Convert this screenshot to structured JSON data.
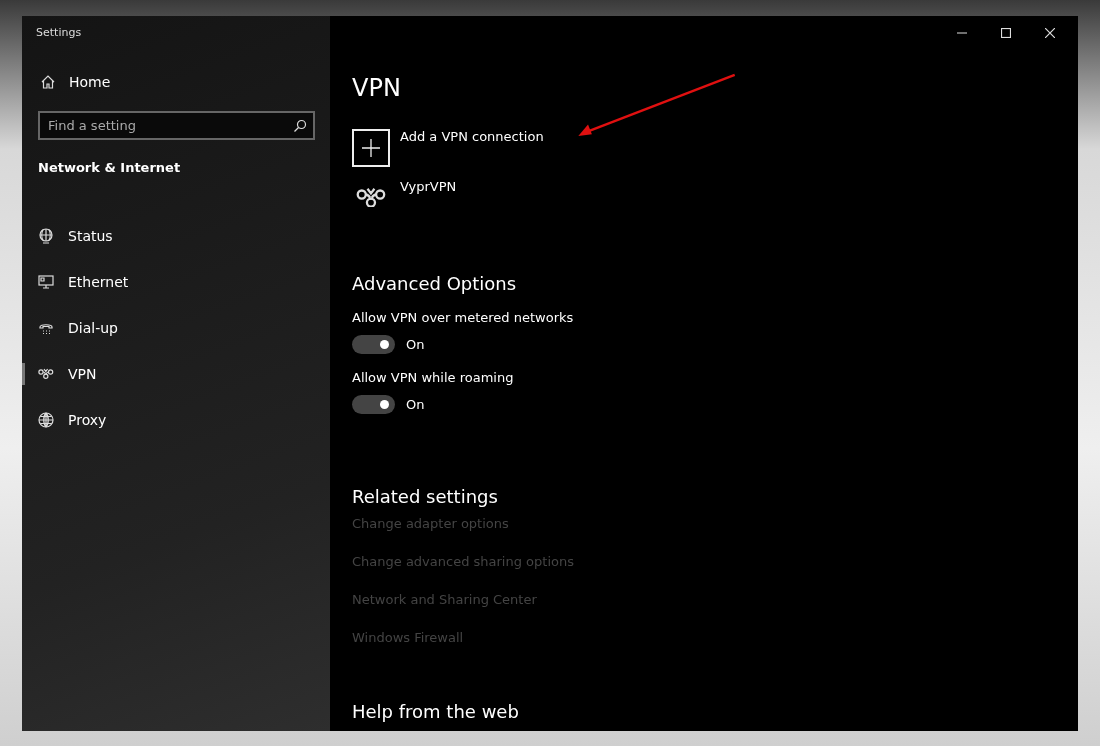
{
  "window": {
    "title": "Settings"
  },
  "sidebar": {
    "home": "Home",
    "search": {
      "placeholder": "Find a setting"
    },
    "section": "Network & Internet",
    "items": [
      {
        "label": "Status",
        "kind": "status",
        "selected": false
      },
      {
        "label": "Ethernet",
        "kind": "ethernet",
        "selected": false
      },
      {
        "label": "Dial-up",
        "kind": "dialup",
        "selected": false
      },
      {
        "label": "VPN",
        "kind": "vpn",
        "selected": true
      },
      {
        "label": "Proxy",
        "kind": "proxy",
        "selected": false
      }
    ]
  },
  "content": {
    "title": "VPN",
    "connections": [
      {
        "kind": "add",
        "label": "Add a VPN connection"
      },
      {
        "kind": "vpn",
        "label": "VyprVPN"
      }
    ],
    "advanced": {
      "heading": "Advanced Options",
      "toggles": [
        {
          "label": "Allow VPN over metered networks",
          "on": true,
          "state": "On"
        },
        {
          "label": "Allow VPN while roaming",
          "on": true,
          "state": "On"
        }
      ]
    },
    "related": {
      "heading": "Related settings",
      "links": [
        "Change adapter options",
        "Change advanced sharing options",
        "Network and Sharing Center",
        "Windows Firewall"
      ]
    },
    "help": {
      "heading": "Help from the web"
    }
  }
}
